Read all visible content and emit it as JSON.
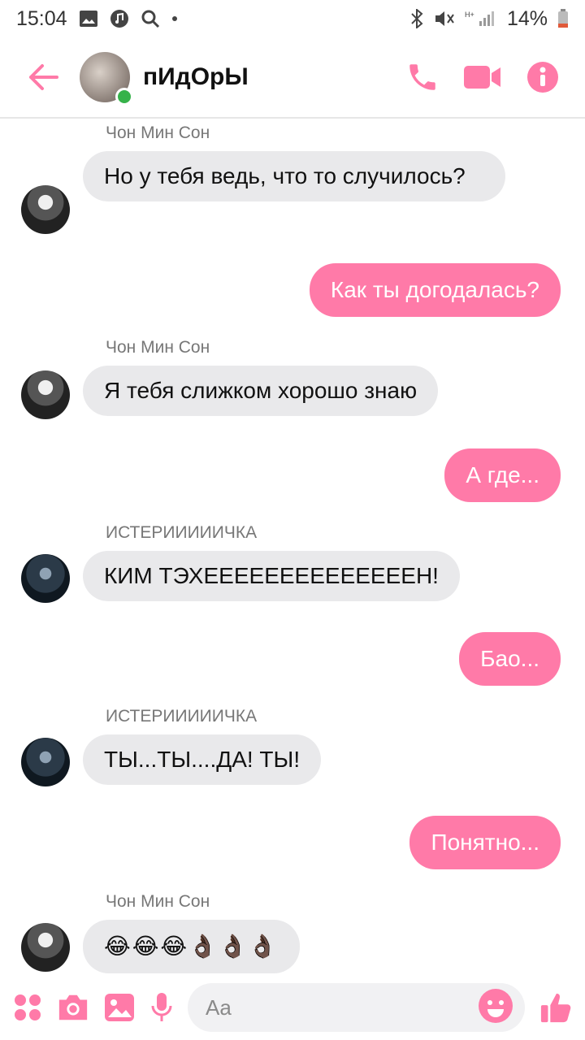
{
  "status_bar": {
    "time": "15:04",
    "battery": "14%"
  },
  "header": {
    "title": "пИдОрЫ"
  },
  "colors": {
    "accent": "#ff7aa8",
    "incoming_bubble": "#e9e9eb",
    "online": "#36b24a"
  },
  "icons": [
    "back-arrow-icon",
    "phone-icon",
    "video-icon",
    "info-icon",
    "apps-icon",
    "camera-icon",
    "gallery-icon",
    "mic-icon",
    "emoji-icon",
    "like-icon"
  ],
  "messages": [
    {
      "sender": "Чон Мин Сон",
      "text": "Но у тебя ведь, что то случилось?"
    },
    {
      "text": "Как ты догодалась?"
    },
    {
      "sender": "Чон Мин Сон",
      "text": "Я тебя слижком хорошо знаю"
    },
    {
      "text": "А где..."
    },
    {
      "sender": "ИСТЕРИИИИИЧКА",
      "text": "КИМ ТЭХЕЕЕЕЕЕЕЕЕЕЕЕЕЕН!"
    },
    {
      "text": "Бао..."
    },
    {
      "sender": "ИСТЕРИИИИИЧКА",
      "text": "ТЫ...ТЫ....ДА! ТЫ!"
    },
    {
      "text": "Понятно..."
    },
    {
      "sender": "Чон Мин Сон",
      "emojis": "😂😂😂👌🏿👌🏿👌🏿"
    }
  ],
  "composer": {
    "placeholder": "Aa"
  }
}
